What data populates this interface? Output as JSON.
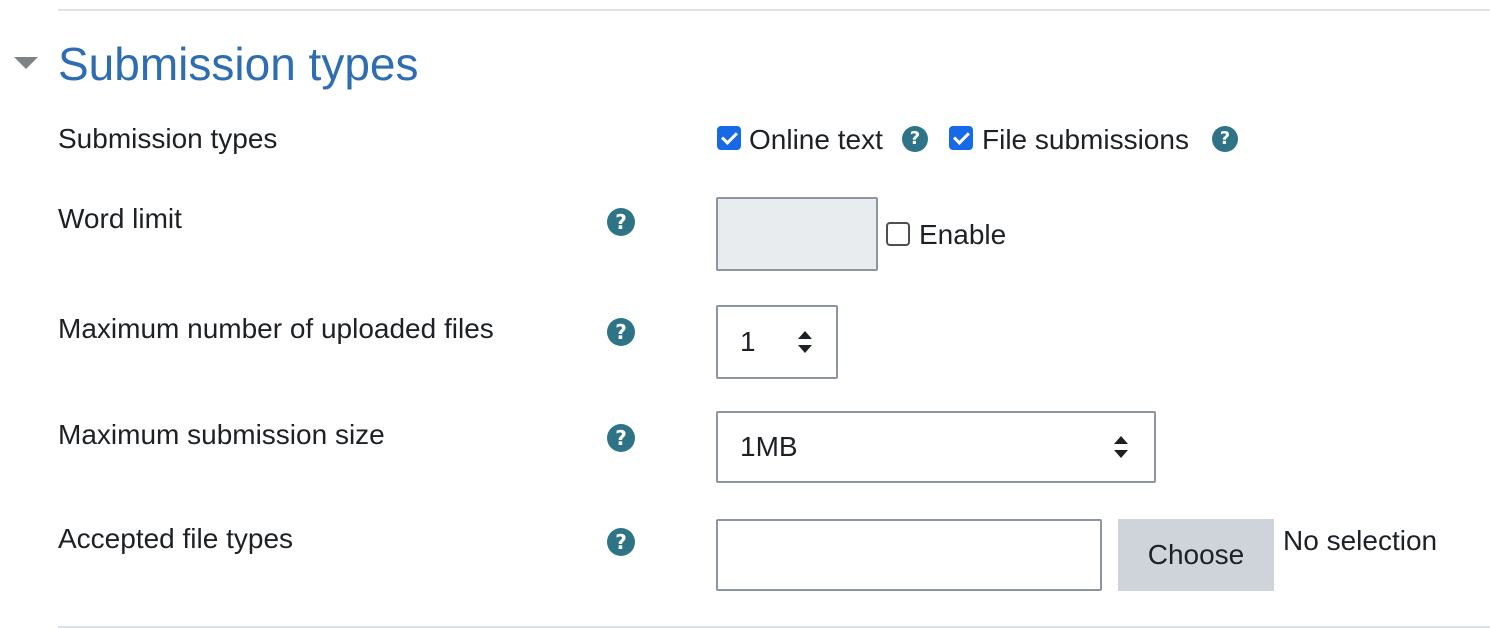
{
  "section": {
    "title": "Submission types"
  },
  "rows": {
    "submission_types": {
      "label": "Submission types",
      "options": [
        {
          "label": "Online text",
          "checked": true
        },
        {
          "label": "File submissions",
          "checked": true
        }
      ]
    },
    "word_limit": {
      "label": "Word limit",
      "value": "",
      "enable_label": "Enable",
      "enable_checked": false
    },
    "max_files": {
      "label": "Maximum number of uploaded files",
      "value": "1"
    },
    "max_size": {
      "label": "Maximum submission size",
      "value": "1MB"
    },
    "file_types": {
      "label": "Accepted file types",
      "value": "",
      "choose_label": "Choose",
      "selection_text": "No selection"
    }
  },
  "icons": {
    "help": "question-circle-icon",
    "section_toggle": "caret-down-icon",
    "help_glyph": "?"
  },
  "colors": {
    "title": "#2f6db3",
    "help_icon": "#2e7486",
    "checkbox_checked": "#1769e8",
    "choose_button": "#ced4da"
  }
}
